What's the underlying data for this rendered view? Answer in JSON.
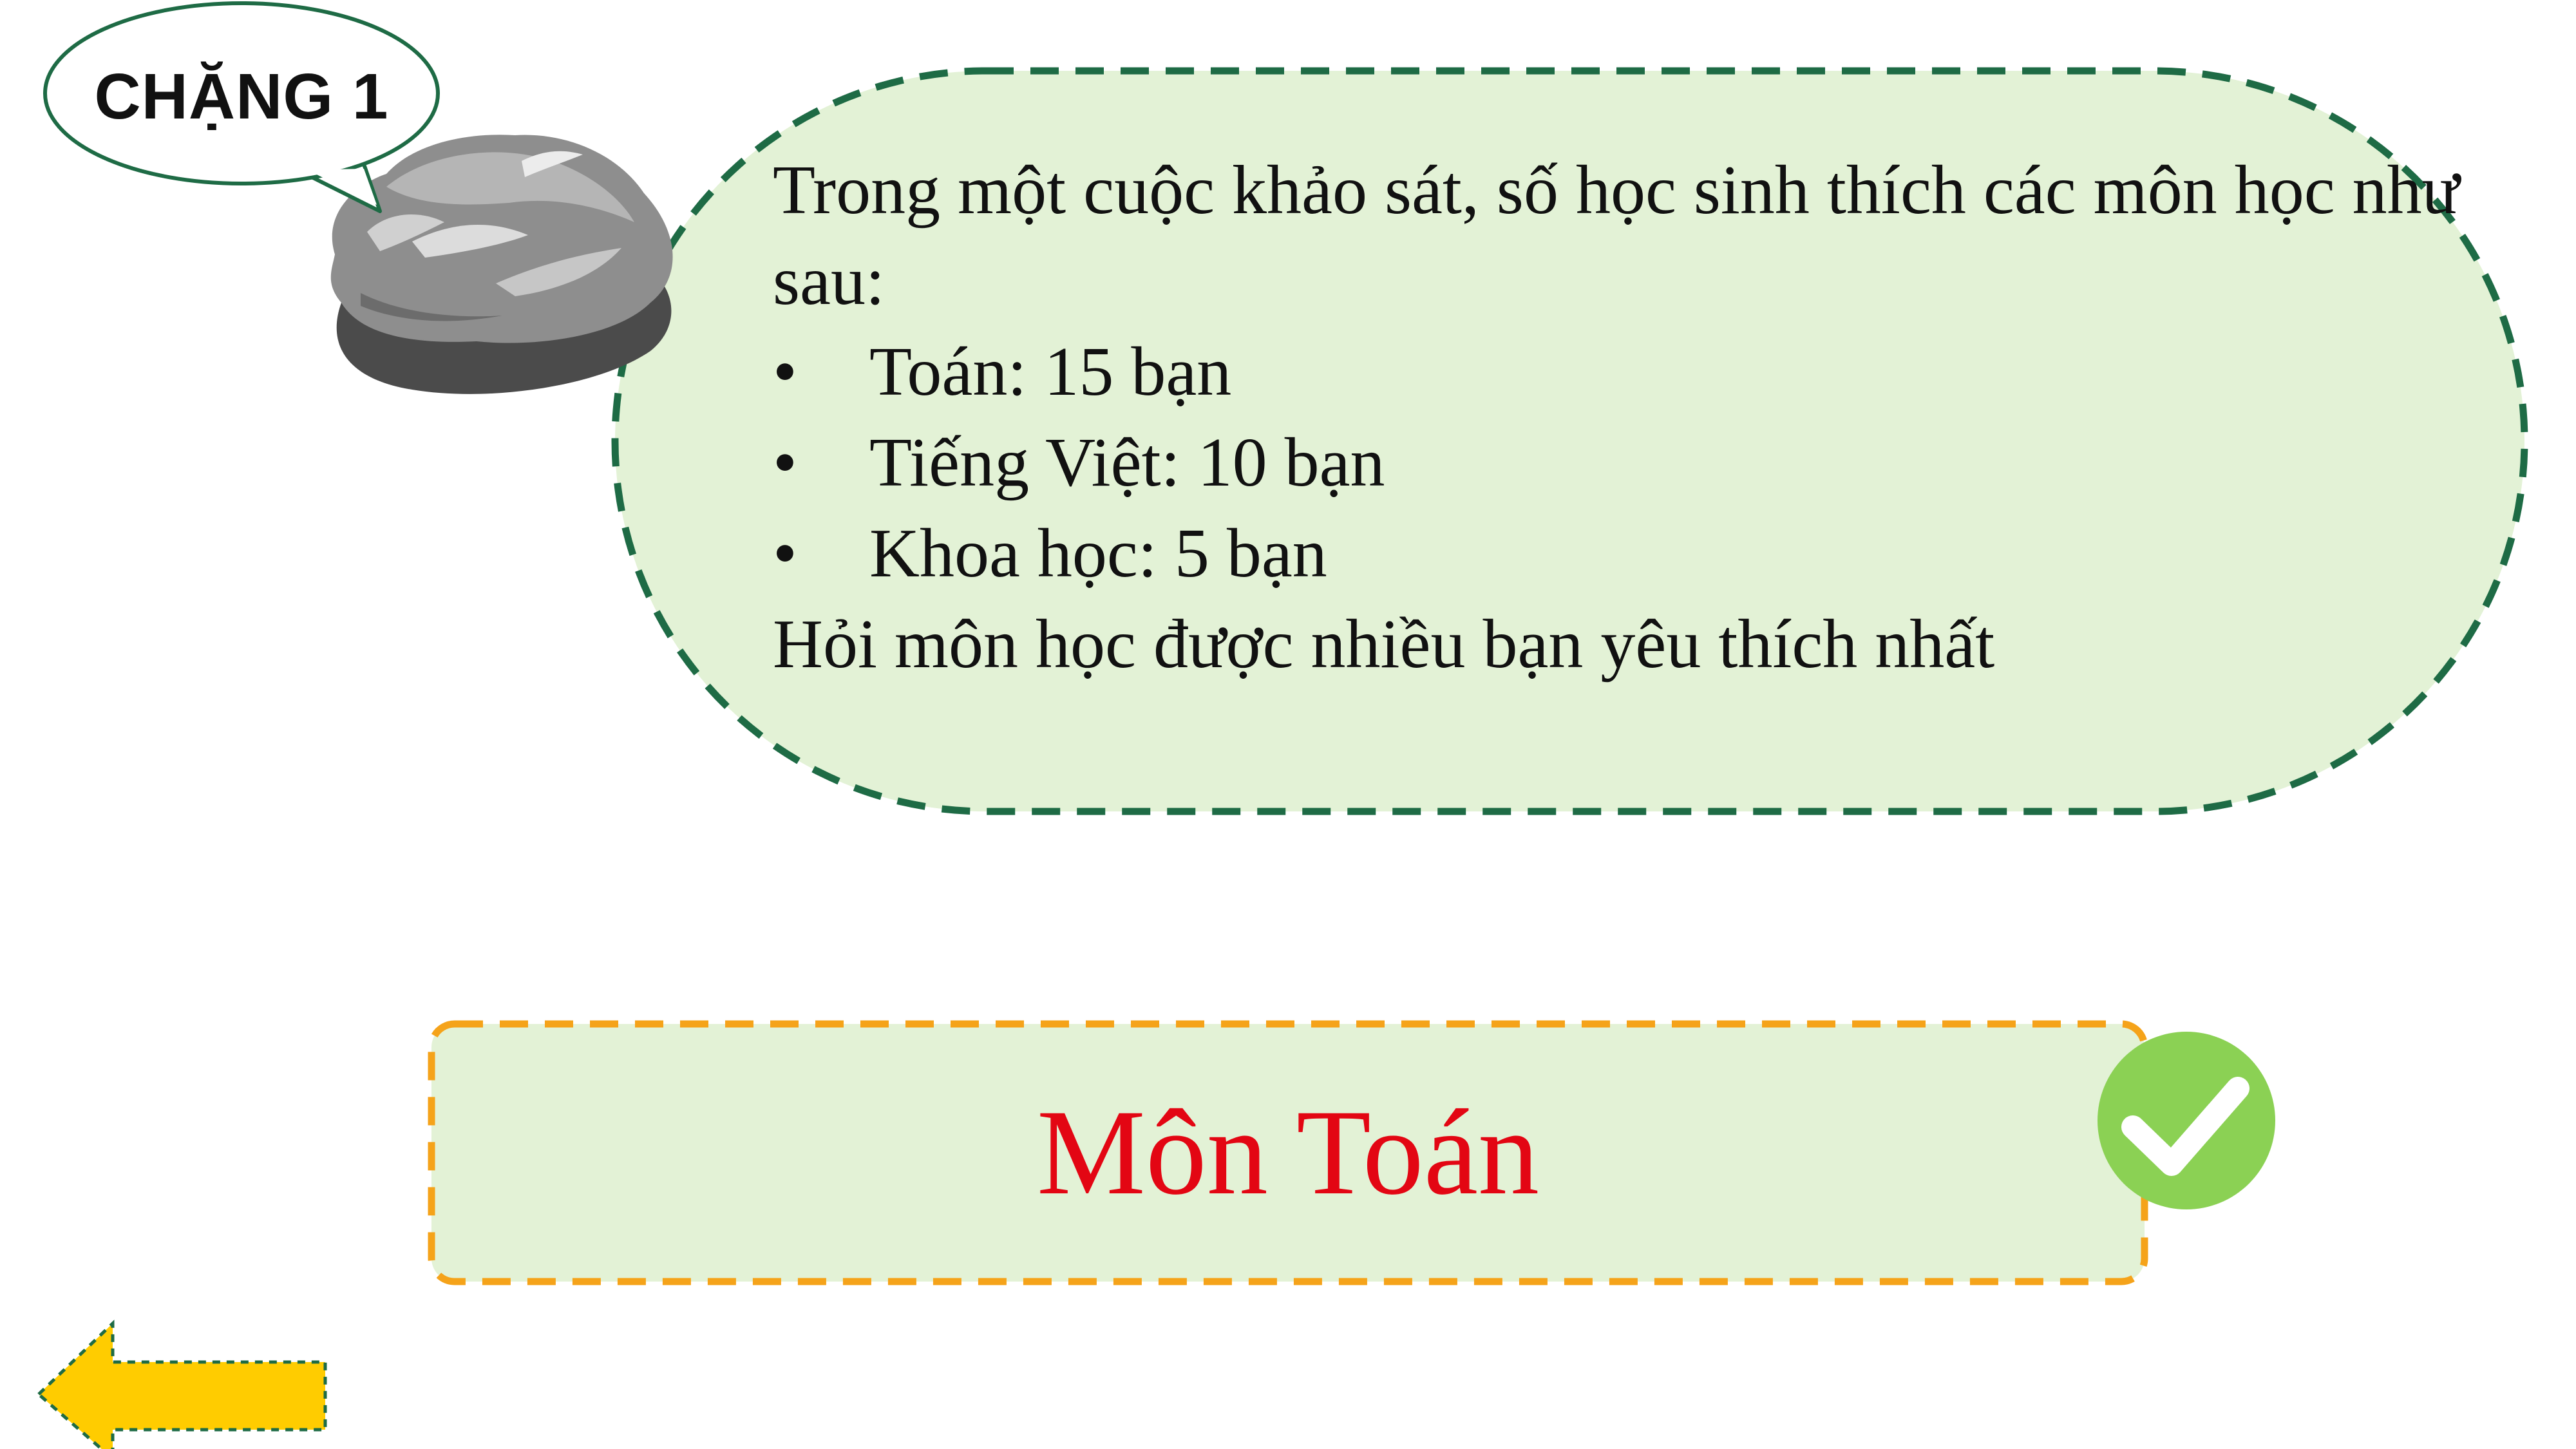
{
  "stage": {
    "label": "CHẶNG 1"
  },
  "question": {
    "intro": "Trong một cuộc khảo sát, số học sinh thích các môn học như sau:",
    "items": [
      {
        "bullet": "•",
        "text": "Toán: 15 bạn"
      },
      {
        "bullet": "•",
        "text": "Tiếng Việt: 10 bạn"
      },
      {
        "bullet": "•",
        "text": "Khoa học: 5 bạn"
      }
    ],
    "prompt": "Hỏi môn học được nhiều bạn yêu thích nhất"
  },
  "answer": {
    "text": "Môn Toán",
    "status": "correct",
    "check_icon": "check-circle-icon"
  },
  "navigation": {
    "back_icon": "arrow-left-icon"
  },
  "colors": {
    "bubble_fill": "#e3f2d6",
    "bubble_border": "#1e6b45",
    "answer_border": "#f5a31a",
    "answer_text": "#e30613",
    "check_fill": "#8bd154",
    "arrow_fill": "#ffcc00",
    "arrow_border": "#1e6b45"
  }
}
